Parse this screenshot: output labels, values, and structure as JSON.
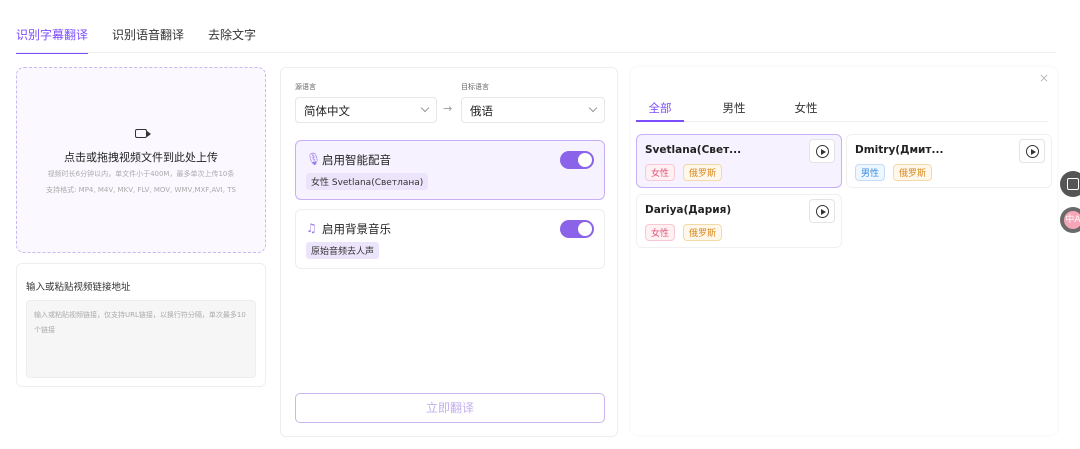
{
  "tabs": [
    {
      "label": "识别字幕翻译",
      "active": true
    },
    {
      "label": "识别语音翻译",
      "active": false
    },
    {
      "label": "去除文字",
      "active": false
    }
  ],
  "upload": {
    "title": "点击或拖拽视频文件到此处上传",
    "limits": "视频时长6分钟以内，单文件小于400M，最多单次上传10条",
    "formats": "支持格式: MP4, M4V, MKV, FLV, MOV, WMV,MXF,AVI, TS",
    "icon": "video-camera-icon"
  },
  "url_input": {
    "label": "输入或粘贴视频链接地址",
    "placeholder": "输入或粘贴视频链接，仅支持URL链接，以换行符分隔，单次最多10个链接"
  },
  "settings": {
    "source_label": "源语言",
    "source_value": "简体中文",
    "target_label": "目标语言",
    "target_value": "俄语",
    "arrow": "→",
    "smart_dub": {
      "title": "启用智能配音",
      "chip": "女性  Svetlana(Светлана)",
      "icon": "microphone-icon",
      "enabled": true
    },
    "bg_music": {
      "title": "启用背景音乐",
      "chip": "原始音频去人声",
      "icon": "music-note-icon",
      "enabled": true
    },
    "translate_button": "立即翻译"
  },
  "voices": {
    "close": "×",
    "tabs": [
      {
        "label": "全部",
        "active": true
      },
      {
        "label": "男性",
        "active": false
      },
      {
        "label": "女性",
        "active": false
      }
    ],
    "cards": [
      {
        "name": "Svetlana(Свет...",
        "gender": "女性",
        "lang": "俄罗斯",
        "selected": true
      },
      {
        "name": "Dmitry(Дмит...",
        "gender": "男性",
        "lang": "俄罗斯",
        "selected": false
      },
      {
        "name": "Dariya(Дария)",
        "gender": "女性",
        "lang": "俄罗斯",
        "selected": false
      }
    ]
  },
  "floating": {
    "tool_icon": "grid-tool-icon",
    "translate_icon": "translate-icon",
    "translate_glyph": "中A"
  },
  "colors": {
    "accent": "#7c4dff",
    "toggle": "#8a63e8",
    "female_tag": "#e0577a",
    "male_tag": "#3b8ee0",
    "lang_tag": "#d98a1f"
  }
}
